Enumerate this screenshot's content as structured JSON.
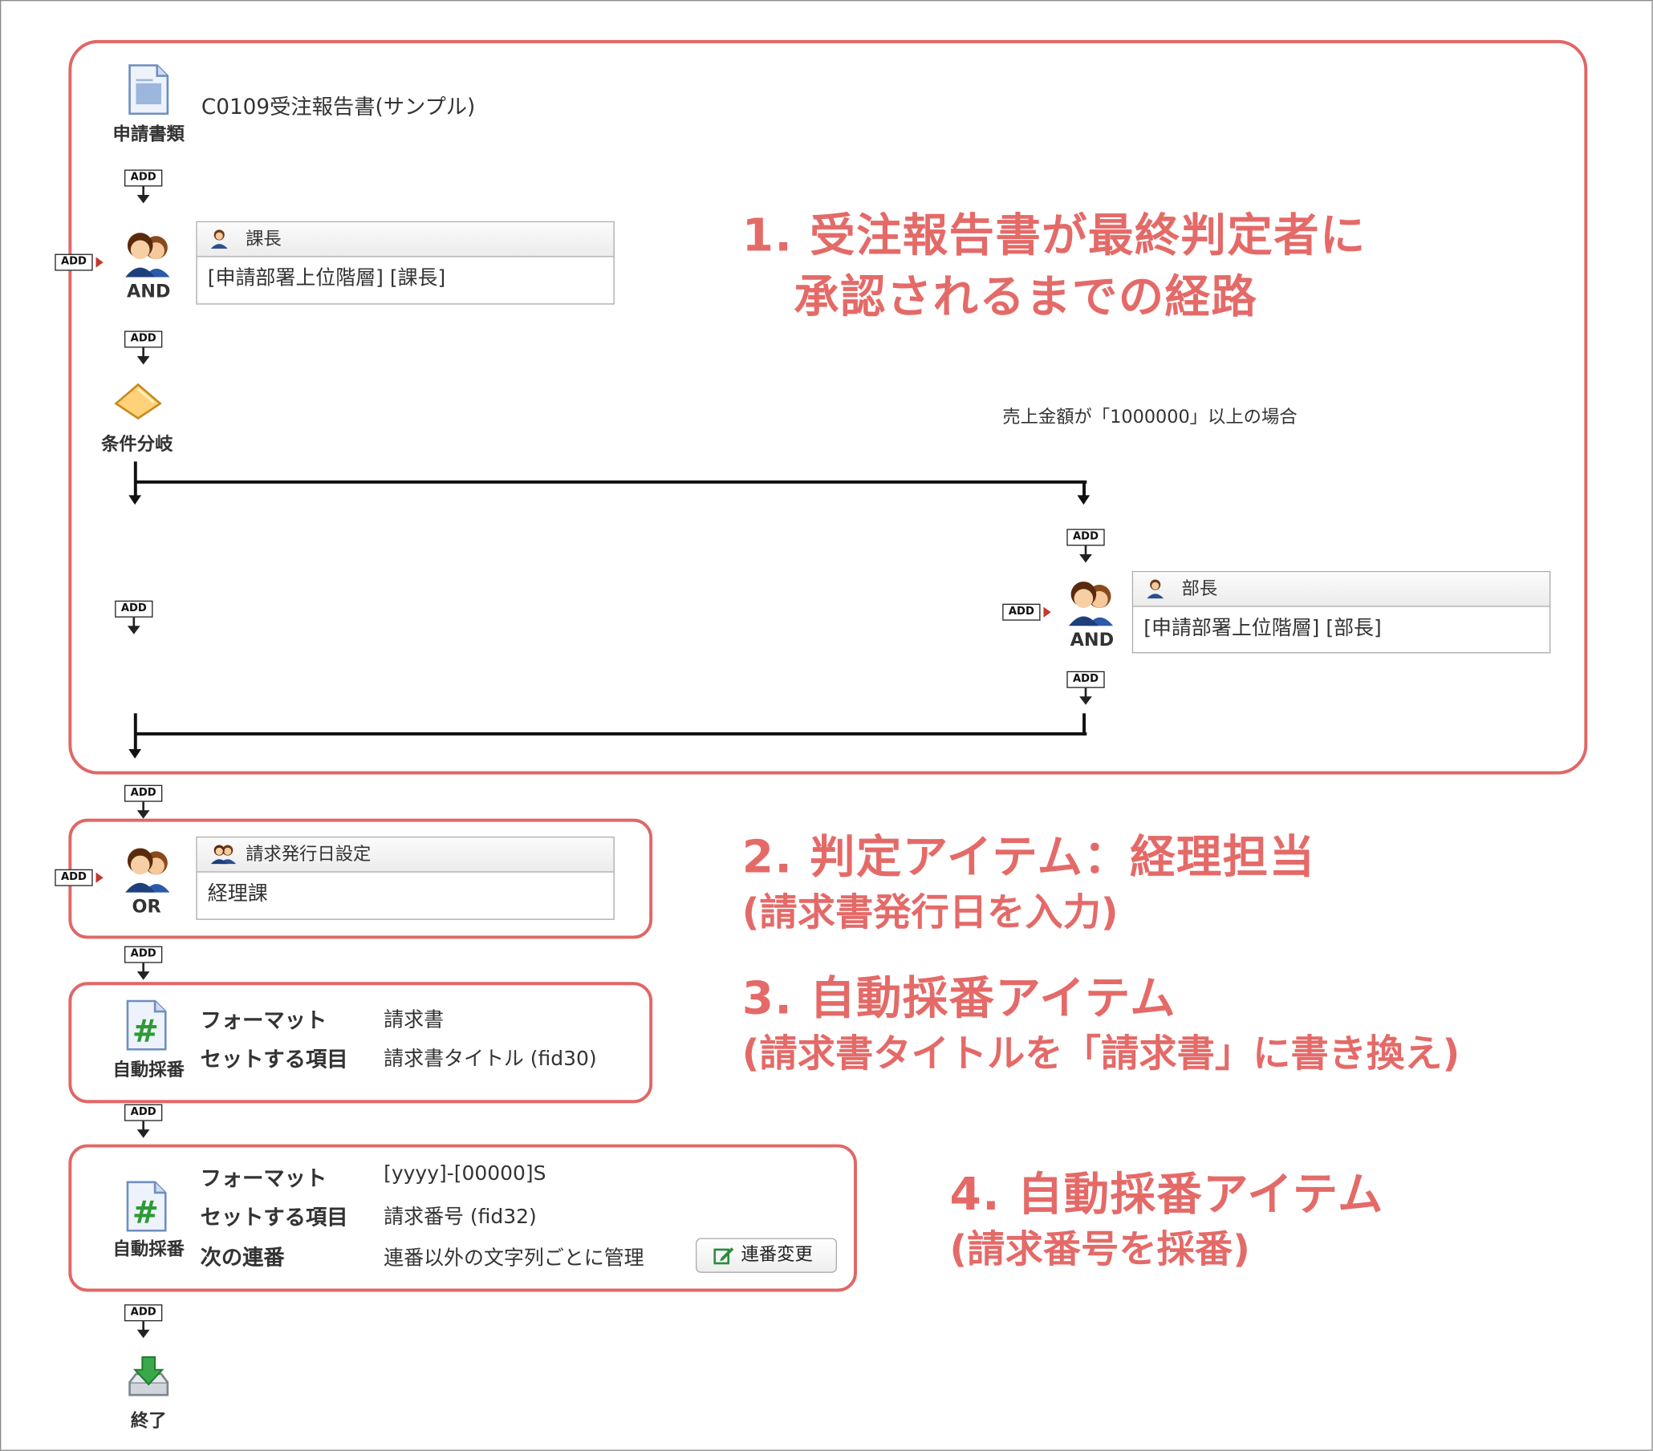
{
  "document": {
    "title": "C0109受注報告書(サンプル)",
    "node_label": "申請書類"
  },
  "add_label": "ADD",
  "approver1": {
    "logic": "AND",
    "header": "課長",
    "body": "[申請部署上位階層] [課長]"
  },
  "branch": {
    "label": "条件分岐",
    "condition": "売上金額が「1000000」以上の場合"
  },
  "approver2": {
    "logic": "AND",
    "header": "部長",
    "body": "[申請部署上位階層] [部長]"
  },
  "judge": {
    "logic": "OR",
    "header": "請求発行日設定",
    "body": "経理課"
  },
  "auto1": {
    "label": "自動採番",
    "format_key": "フォーマット",
    "format_value": "請求書",
    "target_key": "セットする項目",
    "target_value": "請求書タイトル (fid30)"
  },
  "auto2": {
    "label": "自動採番",
    "format_key": "フォーマット",
    "format_value": "[yyyy]-[00000]S",
    "target_key": "セットする項目",
    "target_value": "請求番号 (fid32)",
    "next_key": "次の連番",
    "next_value": "連番以外の文字列ごとに管理",
    "button_label": "連番変更"
  },
  "end": {
    "label": "終了"
  },
  "annotations": {
    "a1_line1": "1.  受注報告書が最終判定者に",
    "a1_line2": "承認されるまでの経路",
    "a2_line1": "2.  判定アイテム：経理担当",
    "a2_line2": "(請求書発行日を入力)",
    "a3_line1": "3.  自動採番アイテム",
    "a3_line2": "(請求書タイトルを「請求書」に書き換え)",
    "a4_line1": "4.  自動採番アイテム",
    "a4_line2": "(請求番号を採番)"
  },
  "colors": {
    "annotation": "#e46a68",
    "frame": "#e06766"
  }
}
